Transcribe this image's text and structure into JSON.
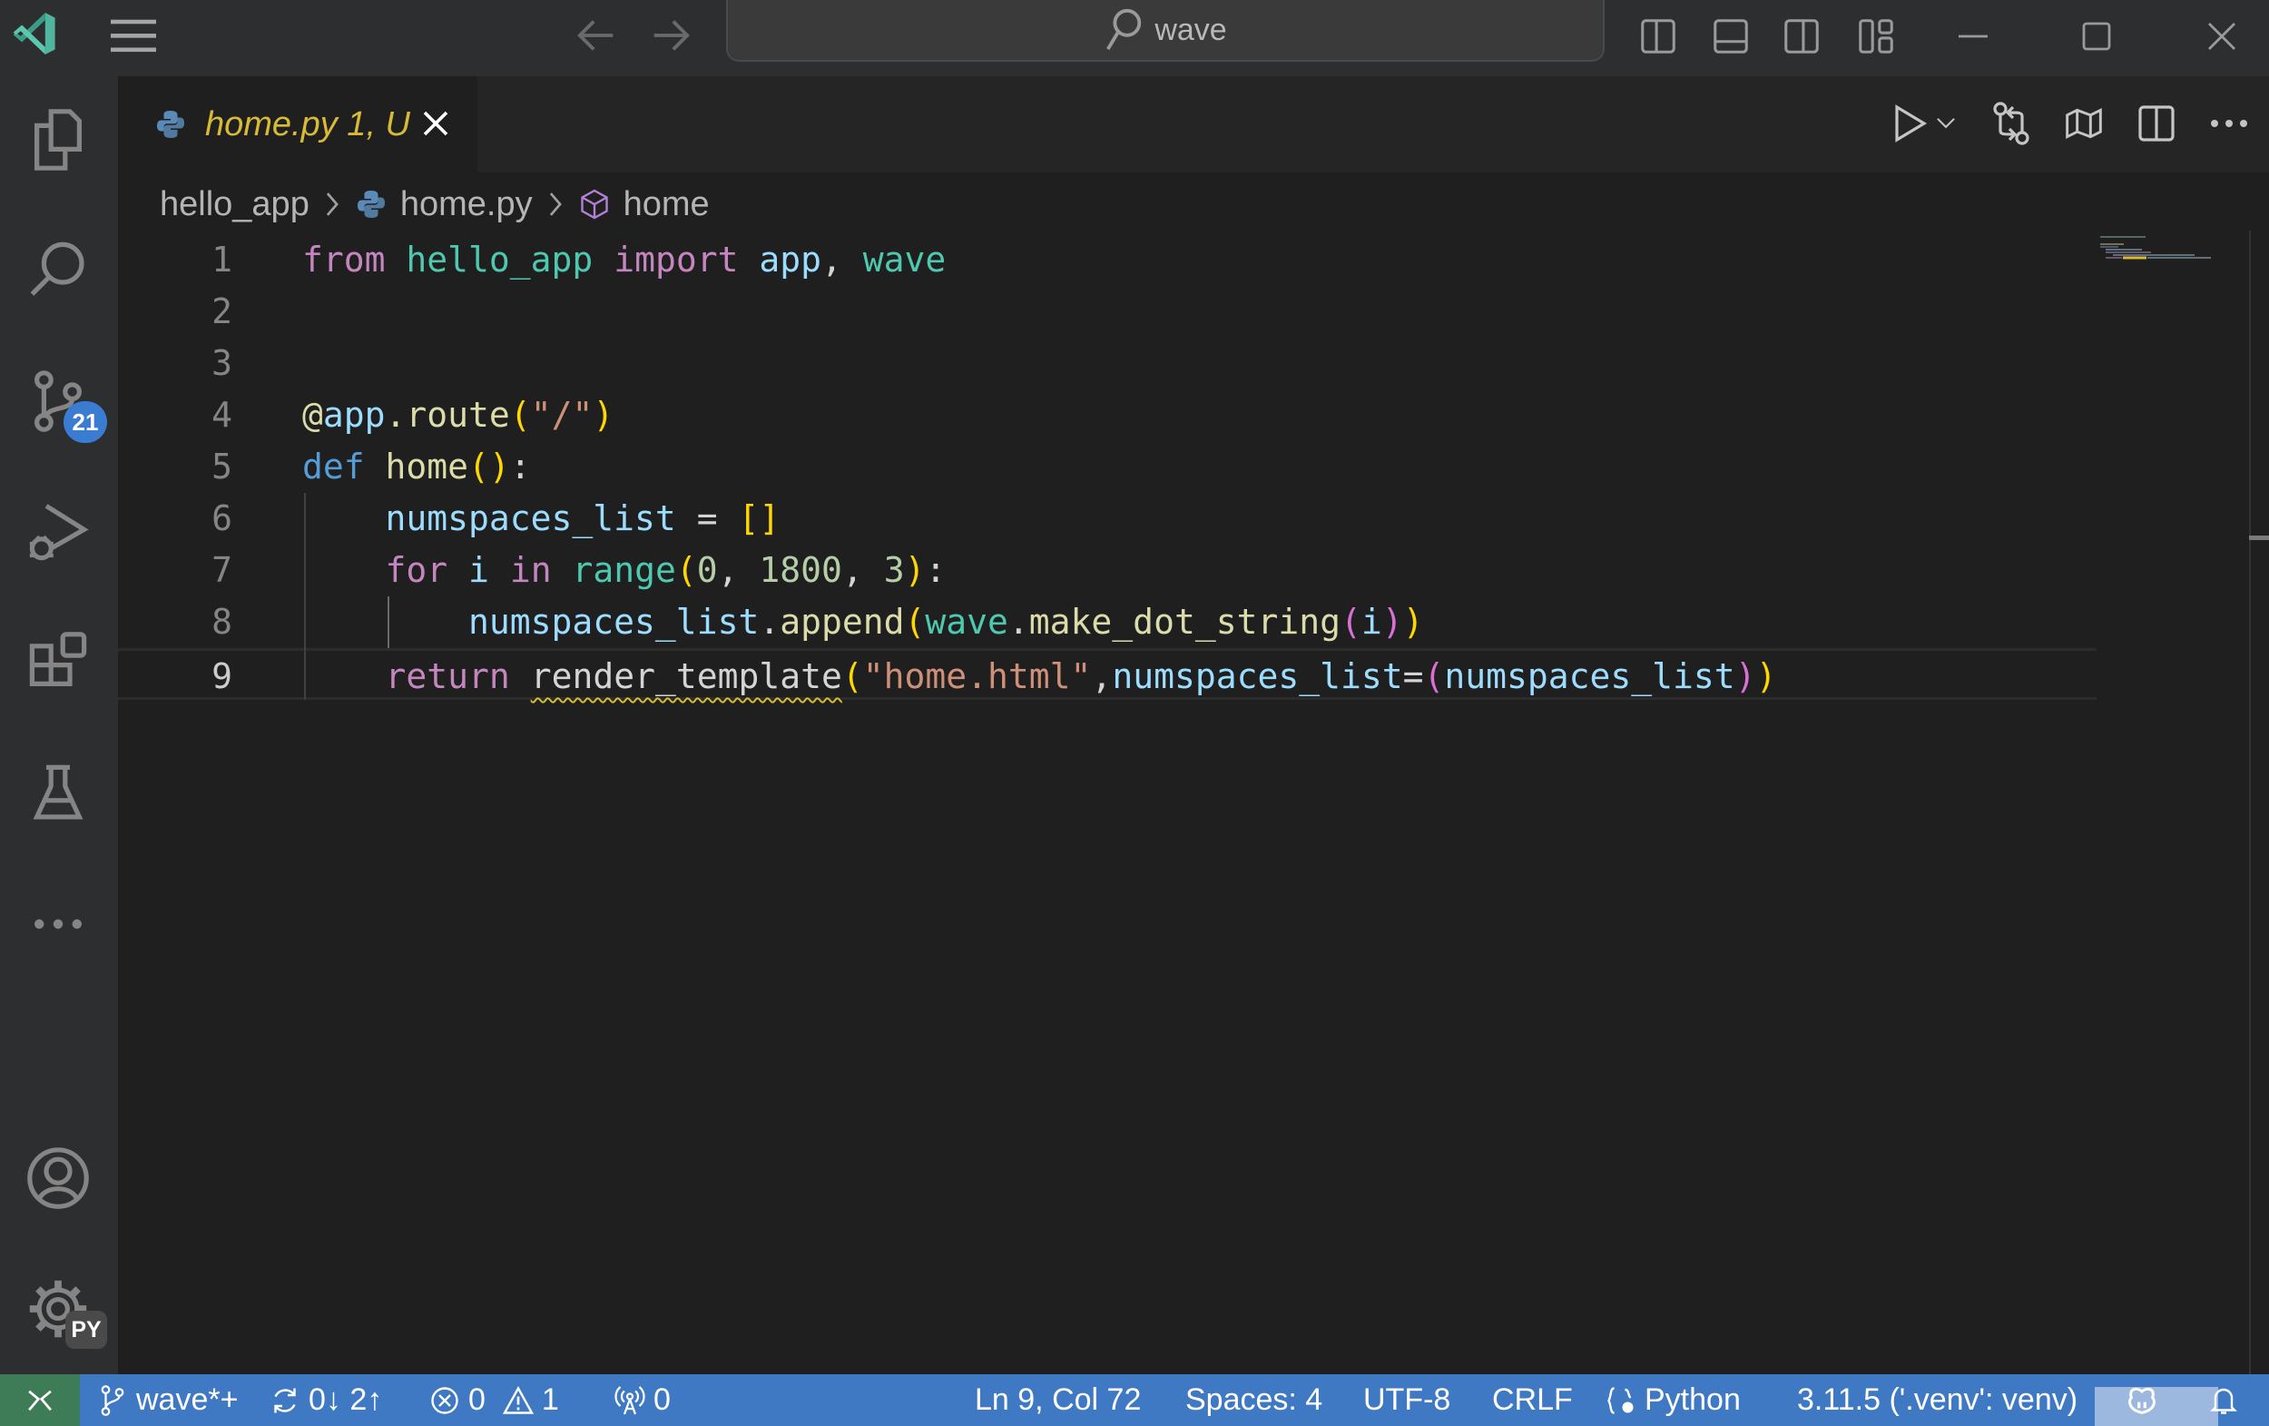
{
  "titlebar": {
    "search_text": "wave",
    "icons": [
      "vscode-logo-icon",
      "menu-icon",
      "back-arrow-icon",
      "forward-arrow-icon",
      "search-icon",
      "toggle-primary-sidebar-icon",
      "toggle-panel-icon",
      "toggle-secondary-sidebar-icon",
      "customize-layout-icon",
      "minimize-icon",
      "maximize-icon",
      "close-icon"
    ]
  },
  "activitybar": {
    "items": [
      {
        "name": "explorer",
        "icon": "files-icon"
      },
      {
        "name": "search",
        "icon": "search-icon"
      },
      {
        "name": "source-control",
        "icon": "source-control-icon",
        "badge": "21"
      },
      {
        "name": "run-debug",
        "icon": "run-debug-icon"
      },
      {
        "name": "extensions",
        "icon": "extensions-icon"
      },
      {
        "name": "testing",
        "icon": "flask-icon"
      },
      {
        "name": "more",
        "icon": "ellipsis-icon"
      }
    ],
    "bottom": [
      {
        "name": "accounts",
        "icon": "account-icon"
      },
      {
        "name": "manage",
        "icon": "gear-icon",
        "badge": "PY"
      }
    ]
  },
  "tab": {
    "label": "home.py 1, U",
    "icon": "python-icon",
    "color": "#d7ba36"
  },
  "editor_actions": [
    "run-icon",
    "run-dropdown-icon",
    "compare-changes-icon",
    "open-preview-icon",
    "split-editor-icon",
    "more-actions-icon"
  ],
  "breadcrumb": {
    "items": [
      {
        "label": "hello_app",
        "icon": ""
      },
      {
        "label": "home.py",
        "icon": "python-icon"
      },
      {
        "label": "home",
        "icon": "symbol-method-icon"
      }
    ]
  },
  "editor": {
    "lines": [
      {
        "n": "1",
        "tokens": [
          [
            "kw",
            "from"
          ],
          [
            "plain",
            " "
          ],
          [
            "mod",
            "hello_app"
          ],
          [
            "plain",
            " "
          ],
          [
            "kw",
            "import"
          ],
          [
            "plain",
            " "
          ],
          [
            "var",
            "app"
          ],
          [
            "plain",
            ", "
          ],
          [
            "mod",
            "wave"
          ]
        ]
      },
      {
        "n": "2",
        "tokens": []
      },
      {
        "n": "3",
        "tokens": []
      },
      {
        "n": "4",
        "tokens": [
          [
            "fn",
            "@"
          ],
          [
            "var",
            "app"
          ],
          [
            "fn",
            ".route"
          ],
          [
            "br1",
            "("
          ],
          [
            "str",
            "\"/\""
          ],
          [
            "br1",
            ")"
          ]
        ]
      },
      {
        "n": "5",
        "tokens": [
          [
            "def",
            "def"
          ],
          [
            "plain",
            " "
          ],
          [
            "fn",
            "home"
          ],
          [
            "br1",
            "()"
          ],
          [
            "plain",
            ":"
          ]
        ]
      },
      {
        "n": "6",
        "tokens": [
          [
            "plain",
            "    "
          ],
          [
            "var",
            "numspaces_list"
          ],
          [
            "plain",
            " = "
          ],
          [
            "br1",
            "[]"
          ]
        ]
      },
      {
        "n": "7",
        "tokens": [
          [
            "plain",
            "    "
          ],
          [
            "kw",
            "for"
          ],
          [
            "plain",
            " "
          ],
          [
            "var",
            "i"
          ],
          [
            "plain",
            " "
          ],
          [
            "kw",
            "in"
          ],
          [
            "plain",
            " "
          ],
          [
            "mod",
            "range"
          ],
          [
            "br1",
            "("
          ],
          [
            "num",
            "0"
          ],
          [
            "plain",
            ", "
          ],
          [
            "num",
            "1800"
          ],
          [
            "plain",
            ", "
          ],
          [
            "num",
            "3"
          ],
          [
            "br1",
            ")"
          ],
          [
            "plain",
            ":"
          ]
        ]
      },
      {
        "n": "8",
        "tokens": [
          [
            "plain",
            "        "
          ],
          [
            "var",
            "numspaces_list"
          ],
          [
            "plain",
            "."
          ],
          [
            "fn",
            "append"
          ],
          [
            "br1",
            "("
          ],
          [
            "mod",
            "wave"
          ],
          [
            "plain",
            "."
          ],
          [
            "fn",
            "make_dot_string"
          ],
          [
            "br2",
            "("
          ],
          [
            "var",
            "i"
          ],
          [
            "br2",
            ")"
          ],
          [
            "br1",
            ")"
          ]
        ]
      },
      {
        "n": "9",
        "tokens": [
          [
            "plain",
            "    "
          ],
          [
            "kw",
            "return"
          ],
          [
            "plain",
            " "
          ],
          [
            "squiggle",
            "render_template"
          ],
          [
            "br1",
            "("
          ],
          [
            "str",
            "\"home.html\""
          ],
          [
            "plain",
            ","
          ],
          [
            "var",
            "numspaces_list"
          ],
          [
            "plain",
            "="
          ],
          [
            "br2",
            "("
          ],
          [
            "var",
            "numspaces_list"
          ],
          [
            "br2",
            ")"
          ],
          [
            "br1",
            ")"
          ]
        ]
      }
    ],
    "current_line": 9
  },
  "statusbar": {
    "branch": "wave*+",
    "sync": "0↓ 2↑",
    "errors": "0",
    "warnings": "1",
    "ports": "0",
    "cursor": "Ln 9, Col 72",
    "indent": "Spaces: 4",
    "encoding": "UTF-8",
    "eol": "CRLF",
    "language": "Python",
    "interpreter": "3.11.5 ('.venv': venv)",
    "accent": "#3f79c4",
    "remote_color": "#3d7c57"
  }
}
